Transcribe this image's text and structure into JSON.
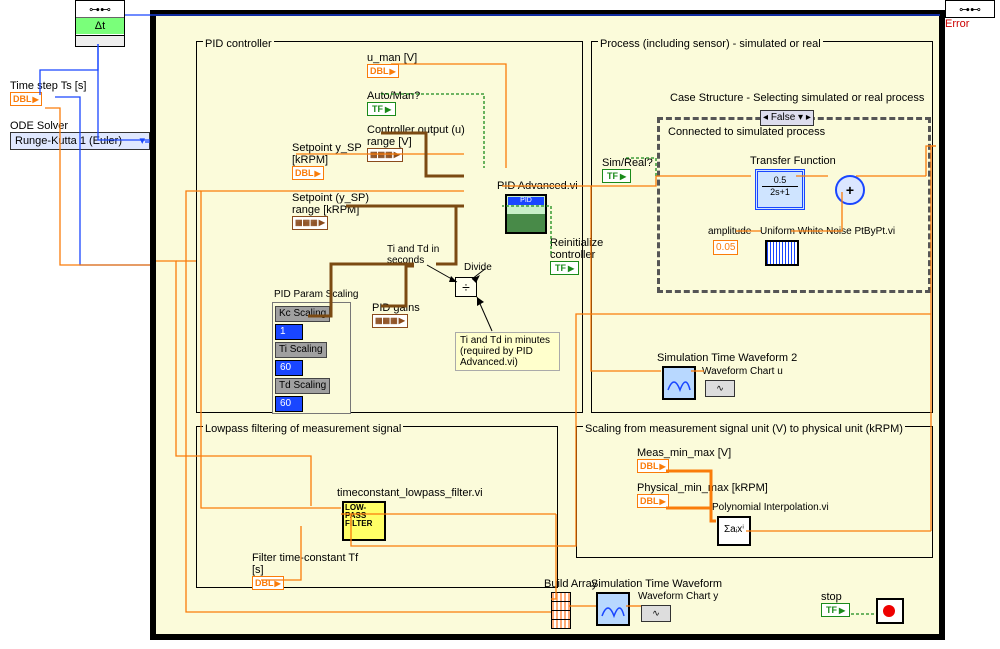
{
  "left_panel": {
    "time_step_label": "Time step Ts [s]",
    "ode_solver_label": "ODE Solver",
    "ode_solver_value": "Runge-Kutta 1 (Euler)",
    "dt_icon": "Δt",
    "dbl": "DBL"
  },
  "error_label": "Error",
  "pid": {
    "frame_title": "PID controller",
    "u_man": "u_man [V]",
    "auto_man": "Auto/Man?",
    "ctrl_out": "Controller output (u) range [V]",
    "setpoint_ysp": "Setpoint y_SP [kRPM]",
    "setpoint_range": "Setpoint (y_SP) range [kRPM]",
    "pid_gains": "PID gains",
    "pid_advanced": "PID Advanced.vi",
    "ti_td_sec": "Ti and Td in seconds",
    "divide": "Divide",
    "reinit": "Reinitialize controller",
    "note": "Ti and Td in minutes (required by PID Advanced.vi)",
    "param_scaling_title": "PID Param Scaling",
    "kc_scaling_label": "Kc Scaling",
    "kc_scaling_value": "1",
    "ti_scaling_label": "Ti Scaling",
    "ti_scaling_value": "60",
    "td_scaling_label": "Td Scaling",
    "td_scaling_value": "60"
  },
  "process": {
    "frame_title": "Process (including sensor) - simulated or real",
    "case_title": "Case Structure - Selecting simulated or real process",
    "case_value": "False",
    "sim_real": "Sim/Real?",
    "connected": "Connected to simulated process",
    "tf_label": "Transfer Function",
    "tf_num": "0.5",
    "tf_den": "2s+1",
    "amplitude_label": "amplitude",
    "amplitude_value": "0.05",
    "noise_vi": "Uniform White Noise PtByPt.vi",
    "sim_wave2": "Simulation Time Waveform 2",
    "wave_chart_u": "Waveform Chart u"
  },
  "lowpass": {
    "frame_title": "Lowpass filtering of measurement signal",
    "tc_vi": "timeconstant_lowpass_filter.vi",
    "tf_label": "Filter time-constant Tf [s]",
    "node_l1": "LOW-",
    "node_l2": "PASS",
    "node_l3": "FILTER"
  },
  "scaling": {
    "frame_title": "Scaling from measurement signal unit (V) to physical unit (kRPM)",
    "meas_label": "Meas_min_max [V]",
    "phys_label": "Physical_min_max [kRPM]",
    "polyint": "Polynomial Interpolation.vi",
    "sigma": "Σaᵢxⁱ"
  },
  "bottom": {
    "build_array": "Build Array",
    "sim_wave": "Simulation Time Waveform",
    "wave_chart_y": "Waveform Chart y",
    "stop": "stop"
  },
  "generic": {
    "dbl": "DBL",
    "tf": "TF",
    "cluster": "▦▦▦"
  }
}
